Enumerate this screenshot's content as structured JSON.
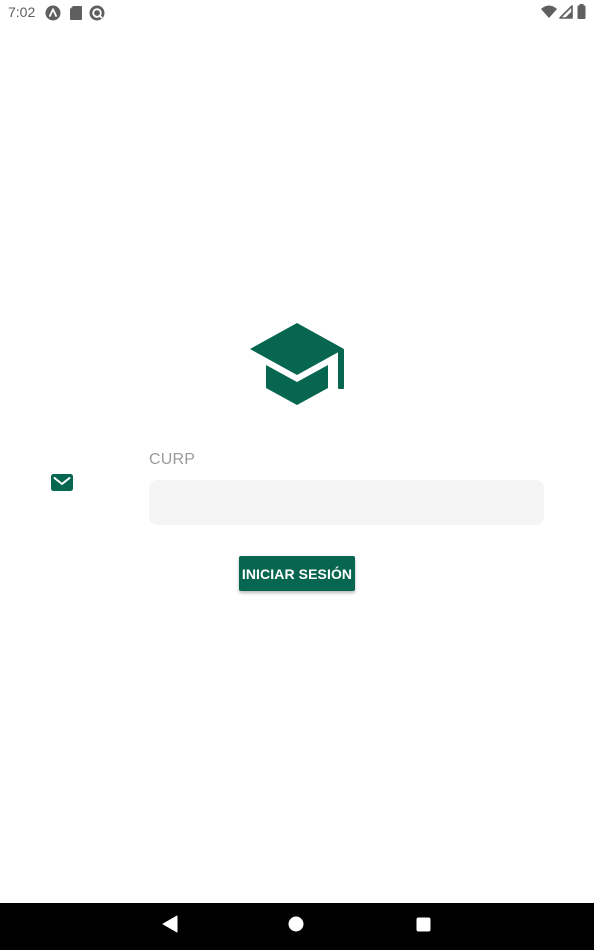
{
  "status_bar": {
    "time": "7:02",
    "left_icons": [
      "a-badge-icon",
      "sd-card-icon",
      "sync-circle-icon"
    ],
    "right_icons": [
      "wifi-icon",
      "signal-icon",
      "battery-icon"
    ]
  },
  "login": {
    "logo_icon": "graduation-cap-icon",
    "field_icon": "mail-icon",
    "curp_label": "CURP",
    "curp_value": "",
    "button_label": "INICIAR SESIÓN"
  },
  "nav_bar": {
    "buttons": [
      "back",
      "home",
      "recents"
    ]
  },
  "colors": {
    "accent": "#07664f",
    "input_background": "#f5f5f5",
    "label": "#9a9a9a"
  }
}
